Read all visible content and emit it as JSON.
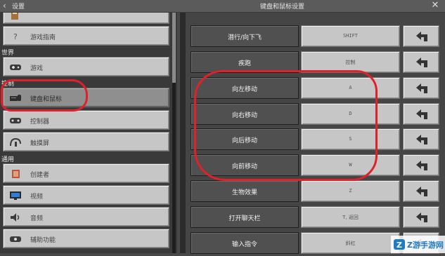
{
  "titlebar": {
    "back_label": "设置",
    "title": "键盘和鼠标设置"
  },
  "sidebar": {
    "items": [
      {
        "label": "",
        "icon": "book-icon"
      },
      {
        "label": "游戏指南",
        "icon": "question-icon"
      },
      {
        "label": "游戏",
        "icon": "gamepad-icon"
      },
      {
        "label": "键盘和鼠标",
        "icon": "keyboard-mouse-icon",
        "selected": true
      },
      {
        "label": "控制器",
        "icon": "controller-icon"
      },
      {
        "label": "触摸屏",
        "icon": "touch-icon"
      },
      {
        "label": "创建者",
        "icon": "creator-icon"
      },
      {
        "label": "视频",
        "icon": "monitor-icon"
      },
      {
        "label": "音频",
        "icon": "speaker-icon"
      },
      {
        "label": "辅助功能",
        "icon": "accessibility-icon"
      }
    ],
    "sections": {
      "world": "世界",
      "controls": "控制",
      "general": "通用"
    }
  },
  "bindings": [
    {
      "action": "潜行/向下飞",
      "key": "SHIFT"
    },
    {
      "action": "疾跑",
      "key": "控制"
    },
    {
      "action": "向左移动",
      "key": "A"
    },
    {
      "action": "向右移动",
      "key": "D"
    },
    {
      "action": "向后移动",
      "key": "S"
    },
    {
      "action": "向前移动",
      "key": "W"
    },
    {
      "action": "生物效果",
      "key": "Z"
    },
    {
      "action": "打开聊天栏",
      "key": "T, 返回"
    },
    {
      "action": "输入指令",
      "key": "斜杠"
    }
  ],
  "watermark": {
    "text": "Z游手游网"
  },
  "colors": {
    "annotation": "#e0202a",
    "panel_bg": "#3a3a3a",
    "button_bg": "#c6c6c6"
  }
}
